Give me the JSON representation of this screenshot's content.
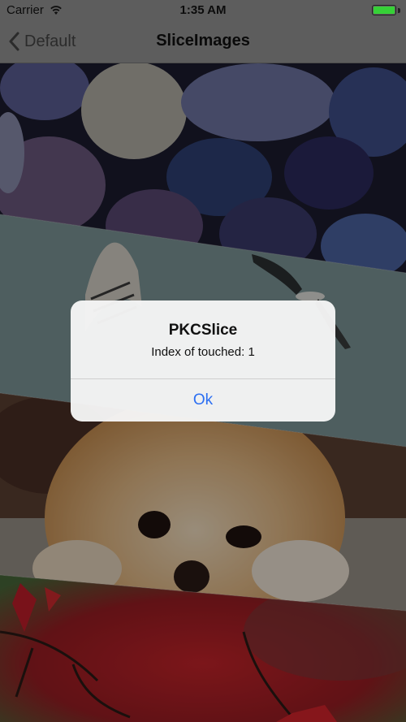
{
  "status_bar": {
    "carrier": "Carrier",
    "time": "1:35 AM",
    "battery_level": 1.0,
    "battery_color": "#36d137"
  },
  "nav_bar": {
    "back_label": "Default",
    "title": "SliceImages",
    "back_icon": "chevron-left-icon"
  },
  "slices": [
    {
      "name": "pebbles",
      "index": 0
    },
    {
      "name": "seagulls",
      "index": 1
    },
    {
      "name": "pomeranian-dog",
      "index": 2
    },
    {
      "name": "red-leaves",
      "index": 3
    }
  ],
  "alert": {
    "title": "PKCSlice",
    "message": "Index of touched: 1",
    "button_label": "Ok",
    "button_color": "#2c6ff2"
  }
}
